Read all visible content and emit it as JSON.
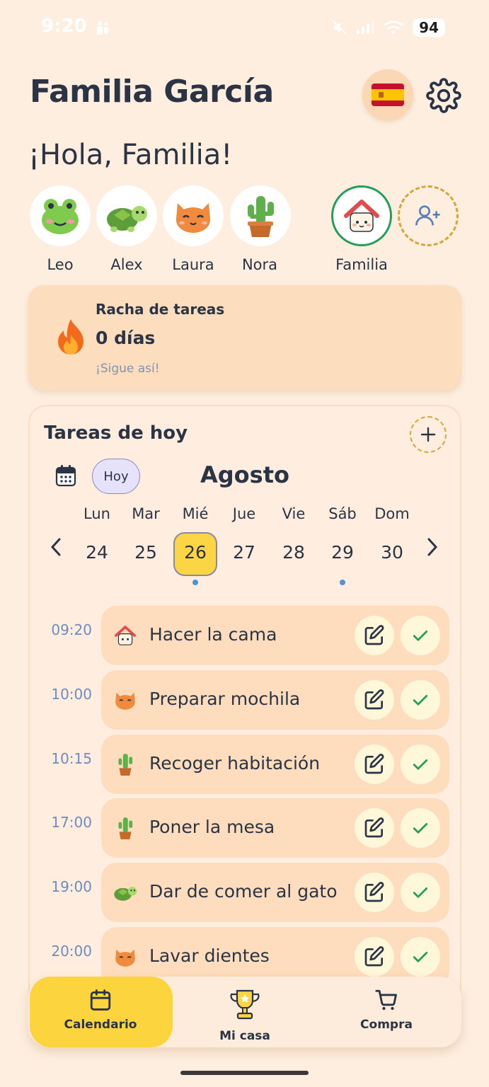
{
  "status_bar": {
    "time": "9:20",
    "battery": "94"
  },
  "header": {
    "title": "Familia García",
    "greeting": "¡Hola, Familia!"
  },
  "members": [
    {
      "name": "Leo",
      "avatar": "frog-icon"
    },
    {
      "name": "Alex",
      "avatar": "turtle-icon"
    },
    {
      "name": "Laura",
      "avatar": "cat-icon"
    },
    {
      "name": "Nora",
      "avatar": "cactus-icon"
    }
  ],
  "family": {
    "name": "Familia",
    "avatar": "house-icon"
  },
  "streak": {
    "title": "Racha de tareas",
    "days": "0 días",
    "subtitle": "¡Sigue así!"
  },
  "tasks": {
    "title": "Tareas de hoy",
    "today_label": "Hoy",
    "month": "Agosto",
    "day_names": [
      "Lun",
      "Mar",
      "Mié",
      "Jue",
      "Vie",
      "Sáb",
      "Dom"
    ],
    "day_numbers": [
      "24",
      "25",
      "26",
      "27",
      "28",
      "29",
      "30"
    ],
    "selected_day": "26",
    "items": [
      {
        "time": "09:20",
        "label": "Hacer la cama",
        "icon": "house-icon"
      },
      {
        "time": "10:00",
        "label": "Preparar mochila",
        "icon": "cat-icon"
      },
      {
        "time": "10:15",
        "label": "Recoger habitación",
        "icon": "cactus-icon"
      },
      {
        "time": "17:00",
        "label": "Poner la mesa",
        "icon": "cactus-icon"
      },
      {
        "time": "19:00",
        "label": "Dar de comer al gato",
        "icon": "turtle-icon"
      },
      {
        "time": "20:00",
        "label": "Lavar dientes",
        "icon": "cat-icon"
      }
    ]
  },
  "nav": {
    "calendar": "Calendario",
    "home": "Mi casa",
    "shopping": "Compra"
  },
  "colors": {
    "background": "#FDEEDF",
    "accent_yellow": "#FCD545",
    "text_dark": "#2B3445",
    "time_blue": "#6B8CBF",
    "check_green": "#22A05A"
  }
}
